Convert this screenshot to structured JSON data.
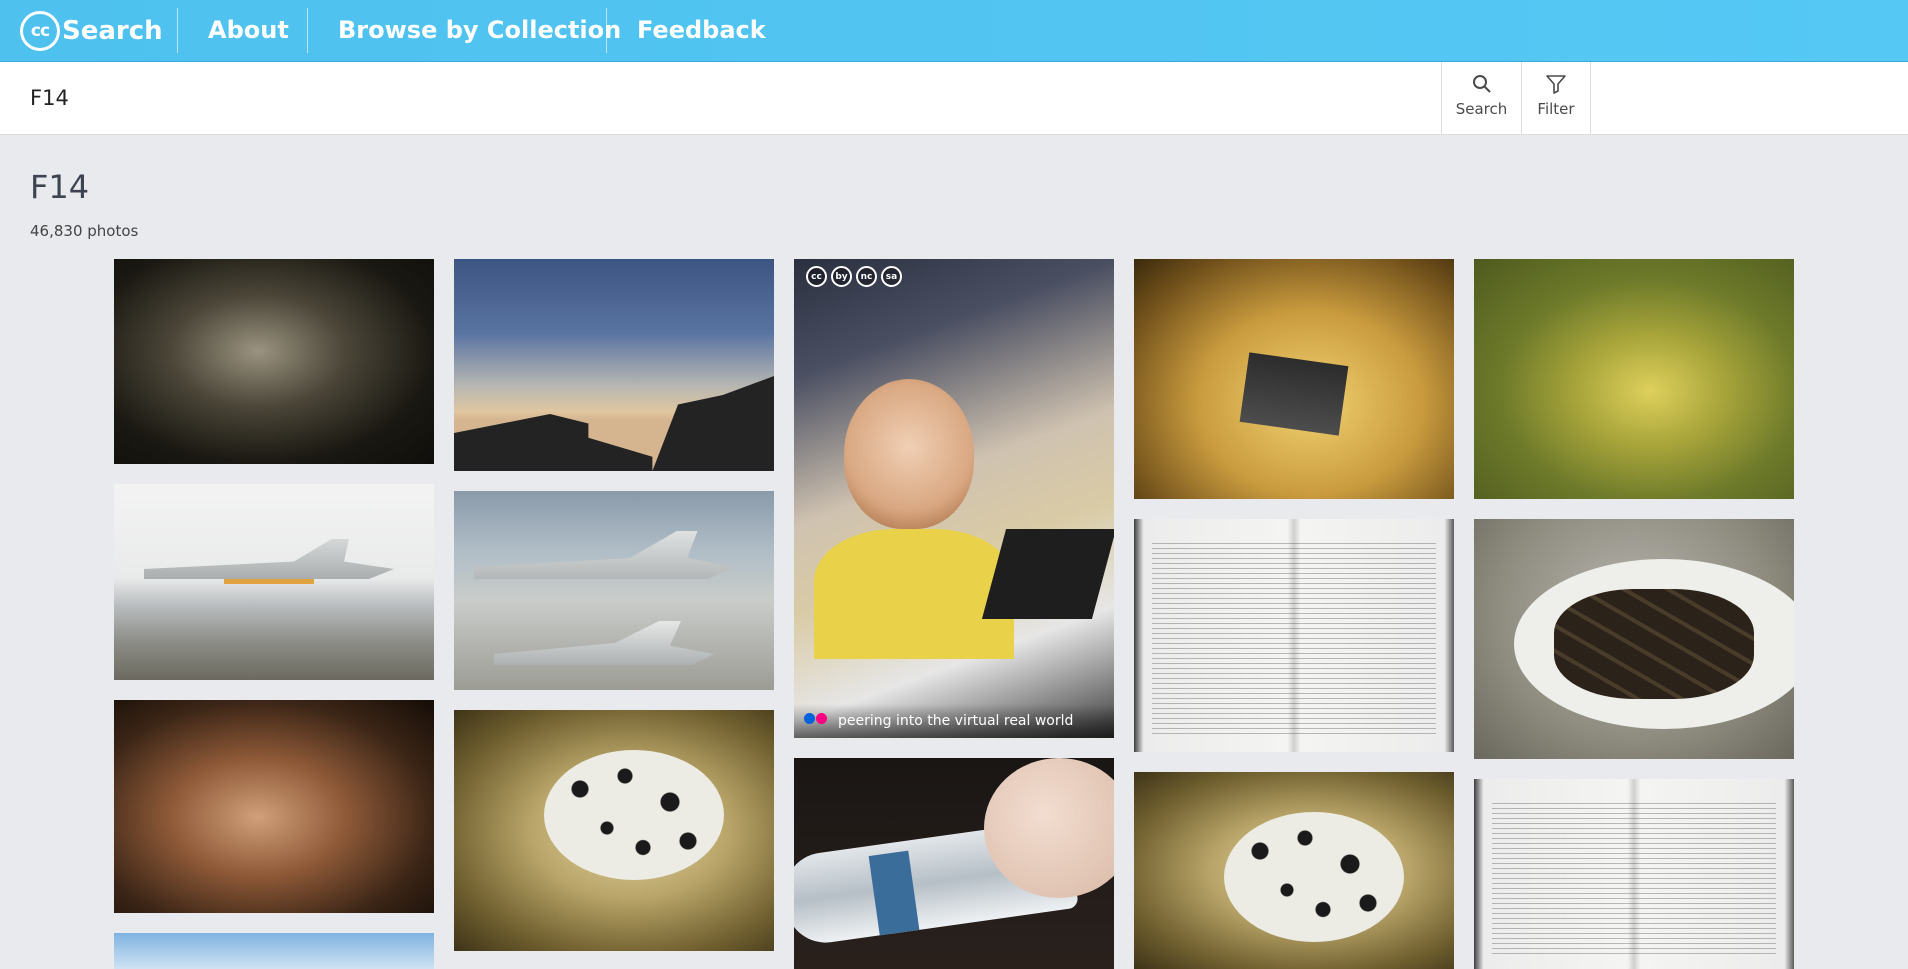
{
  "header": {
    "logo_cc": "cc",
    "logo_word": "Search",
    "nav": [
      "About",
      "Browse by Collection",
      "Feedback"
    ]
  },
  "search": {
    "query": "F14",
    "search_label": "Search",
    "filter_label": "Filter"
  },
  "results": {
    "title": "F14",
    "count": "46,830 photos"
  },
  "featured_photo": {
    "license_icons": [
      "cc",
      "by",
      "nc",
      "sa"
    ],
    "source_icon": "flickr-icon",
    "caption": "peering into the virtual real world"
  },
  "colors": {
    "header_blue": "#55c8f4",
    "page_background": "#e9eaee"
  }
}
